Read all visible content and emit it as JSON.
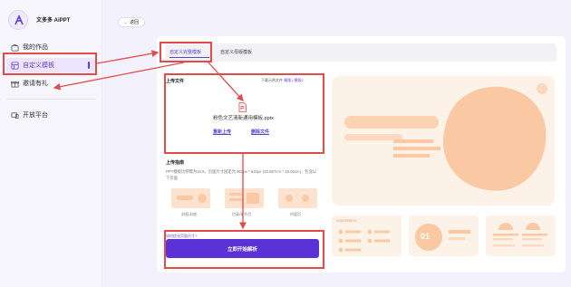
{
  "brand": {
    "name": "文多多 AiPPT"
  },
  "sidebar": {
    "items": [
      {
        "label": "我的作品",
        "icon": "briefcase-icon"
      },
      {
        "label": "自定义模板",
        "icon": "template-icon",
        "active": true
      },
      {
        "label": "邀请有礼",
        "icon": "gift-icon"
      },
      {
        "label": "开放平台",
        "icon": "platform-icon"
      }
    ]
  },
  "header": {
    "back_label": "← 返回"
  },
  "tabs": [
    {
      "label": "自定义完整模板",
      "active": true
    },
    {
      "label": "自定义母版模板",
      "active": false
    }
  ],
  "upload": {
    "title": "上传文件",
    "download_prefix": "下载示例文件",
    "download_sample": "模版1",
    "download_sample2": "模版2",
    "file_name": "粉色文艺清新通用模板.pptx",
    "reupload_label": "重新上传",
    "delete_label": "删除文件"
  },
  "guide": {
    "title": "上传指南",
    "text": "PPT模板比例需为16:9，页面尺寸固定为 960px * 540px (33.867cm * 19.05cm)，包含以下页面",
    "thumbs": [
      "封面/封底",
      "目录/章节页",
      "内容页"
    ]
  },
  "help_link": "如何优化页面尺寸?",
  "primary_button": "立即开始解析",
  "preview": {
    "small_title": "CONTENTS",
    "number_badge": "01"
  },
  "colors": {
    "accent": "#5b32d6",
    "highlight": "#e34b4b",
    "preview_bg": "#fdf2e8",
    "preview_shape": "#fbc8a4"
  }
}
